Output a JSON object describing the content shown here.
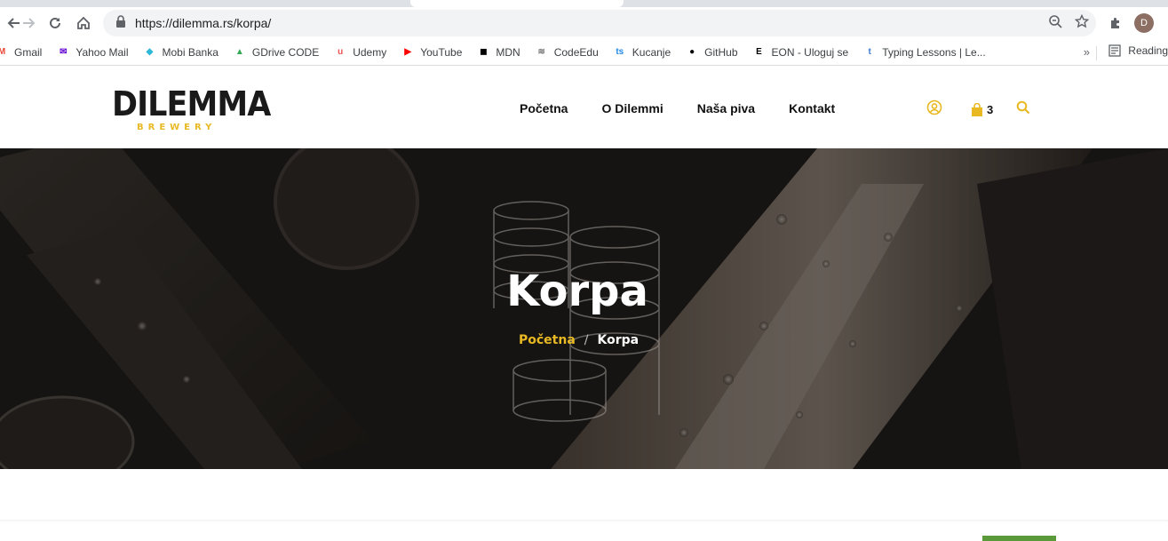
{
  "browser": {
    "url": "https://dilemma.rs/korpa/",
    "avatar_letter": "D",
    "reading_list_label": "Reading",
    "bookmarks": [
      {
        "label": "Gmail",
        "icon": "gmail-icon",
        "color": "#ea4335"
      },
      {
        "label": "Yahoo Mail",
        "icon": "yahoo-icon",
        "color": "#6001d2"
      },
      {
        "label": "Mobi Banka",
        "icon": "mobi-banka-icon",
        "color": "#2eb7d6"
      },
      {
        "label": "GDrive CODE",
        "icon": "gdrive-icon",
        "color": "#34a853"
      },
      {
        "label": "Udemy",
        "icon": "udemy-icon",
        "color": "#ec5252"
      },
      {
        "label": "YouTube",
        "icon": "youtube-icon",
        "color": "#ff0000"
      },
      {
        "label": "MDN",
        "icon": "mdn-icon",
        "color": "#000000"
      },
      {
        "label": "CodeEdu",
        "icon": "codeedu-icon",
        "color": "#777777"
      },
      {
        "label": "Kucanje",
        "icon": "ts-icon",
        "color": "#1e88e5"
      },
      {
        "label": "GitHub",
        "icon": "github-icon",
        "color": "#000000"
      },
      {
        "label": "EON - Uloguj se",
        "icon": "eon-icon",
        "color": "#000000"
      },
      {
        "label": "Typing Lessons | Le...",
        "icon": "typing-icon",
        "color": "#3a7bd5"
      }
    ]
  },
  "site": {
    "logo_word": "DILEMMA",
    "logo_sub": "BREWERY",
    "accent": "#e8b923",
    "menu": [
      "Početna",
      "O Dilemmi",
      "Naša piva",
      "Kontakt"
    ],
    "cart_count": "3"
  },
  "hero": {
    "title": "Korpa",
    "breadcrumb_home": "Početna",
    "breadcrumb_sep": "/",
    "breadcrumb_current": "Korpa"
  }
}
